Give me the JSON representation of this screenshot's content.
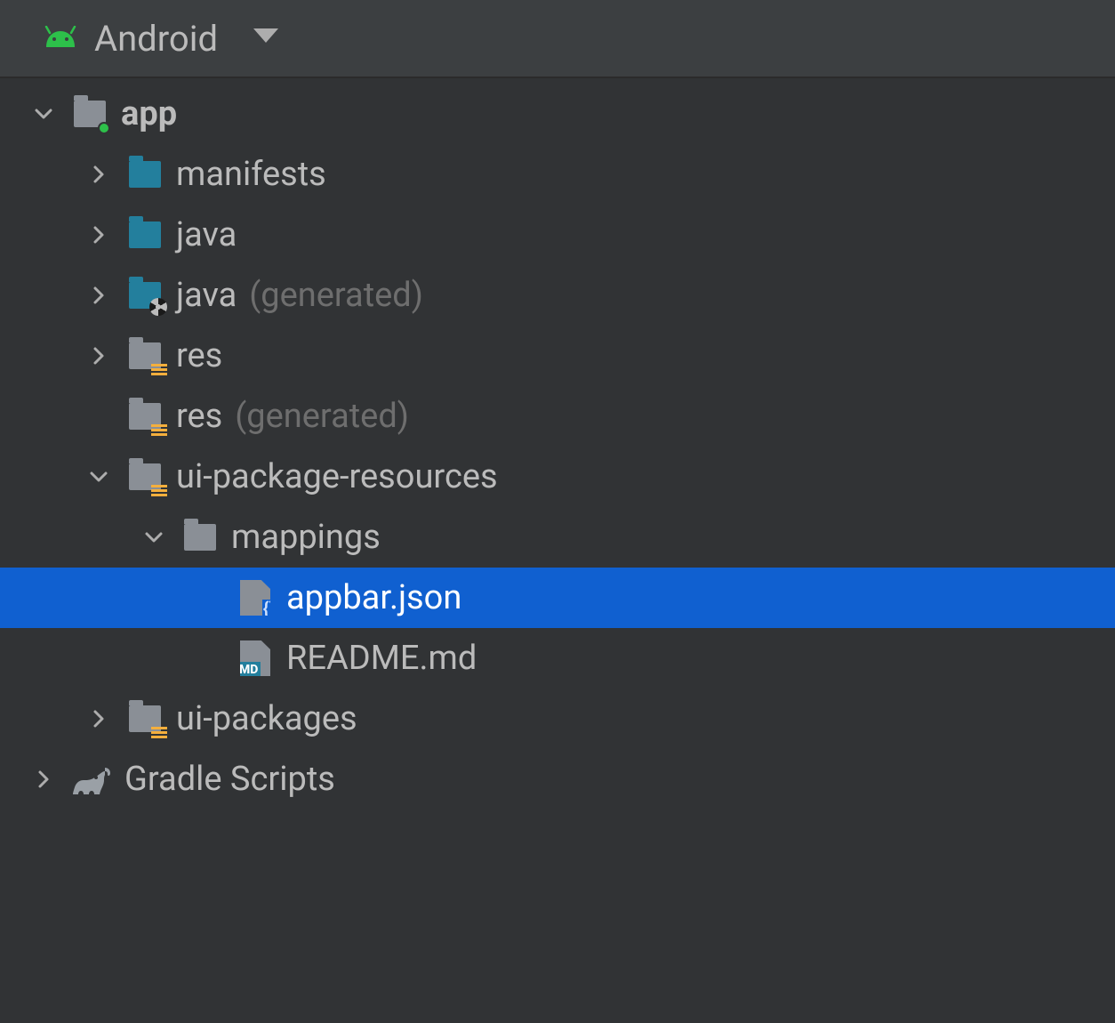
{
  "toolbar": {
    "view_label": "Android"
  },
  "tree": {
    "app": {
      "label": "app"
    },
    "manifests": {
      "label": "manifests"
    },
    "java": {
      "label": "java"
    },
    "java_gen": {
      "label": "java",
      "suffix": "(generated)"
    },
    "res": {
      "label": "res"
    },
    "res_gen": {
      "label": "res",
      "suffix": "(generated)"
    },
    "ui_pkg_res": {
      "label": "ui-package-resources"
    },
    "mappings": {
      "label": "mappings"
    },
    "appbar_json": {
      "label": "appbar.json"
    },
    "readme": {
      "label": "README.md"
    },
    "ui_pkgs": {
      "label": "ui-packages"
    },
    "gradle": {
      "label": "Gradle Scripts"
    }
  }
}
